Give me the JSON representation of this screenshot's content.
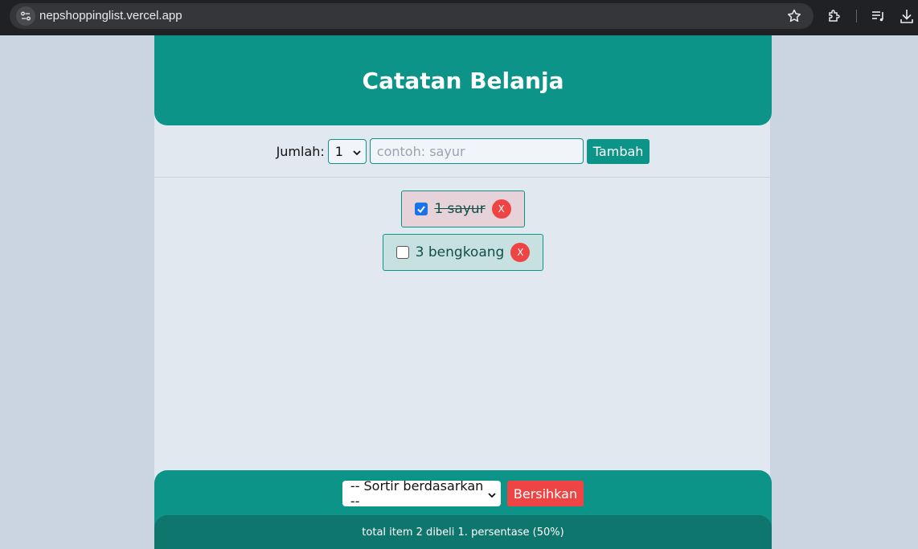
{
  "browser": {
    "url": "nepshoppinglist.vercel.app"
  },
  "app": {
    "title": "Catatan Belanja"
  },
  "form": {
    "qty_label": "Jumlah:",
    "qty_value": "1",
    "name_placeholder": "contoh: sayur",
    "add_label": "Tambah"
  },
  "items": [
    {
      "text": "1 sayur",
      "checked": true,
      "delete_label": "X"
    },
    {
      "text": "3 bengkoang",
      "checked": false,
      "delete_label": "X"
    }
  ],
  "footer": {
    "sort_selected": "-- Sortir berdasarkan --",
    "clear_label": "Bersihkan",
    "stats": "total item 2 dibeli 1. persentase (50%)"
  },
  "colors": {
    "primary": "#0d9488",
    "primary_dark": "#0f766e",
    "danger": "#ef4444",
    "background": "#e2e8f0"
  },
  "icons": [
    "site-info-icon",
    "bookmark-star-icon",
    "extensions-icon",
    "media-queue-icon",
    "download-icon",
    "chevron-down-icon",
    "checkmark-icon"
  ]
}
